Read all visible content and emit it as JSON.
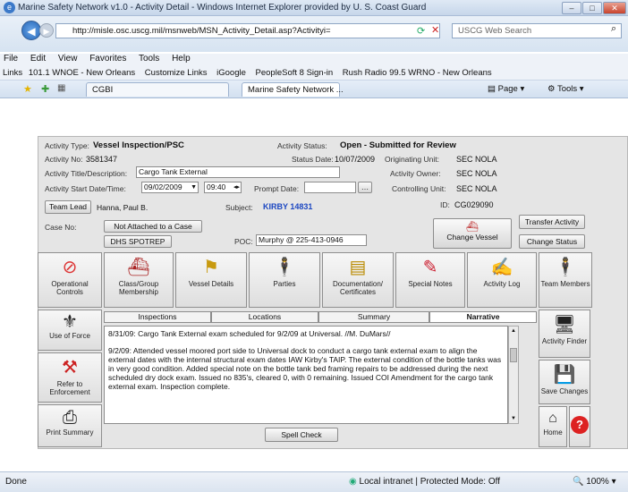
{
  "window": {
    "title": "Marine Safety Network v1.0 - Activity Detail - Windows Internet Explorer provided by U. S. Coast Guard"
  },
  "browser": {
    "address": "http://misle.osc.uscg.mil/msnweb/MSN_Activity_Detail.asp?Activityi=",
    "search_placeholder": "USCG Web Search",
    "menu": [
      "File",
      "Edit",
      "View",
      "Favorites",
      "Tools",
      "Help"
    ],
    "links": [
      "Links",
      "101.1 WNOE - New Orleans",
      "Customize Links",
      "iGoogle",
      "PeopleSoft 8 Sign-in",
      "Rush Radio 99.5 WRNO - New Orleans"
    ],
    "tabs": [
      "CGBI",
      "Marine Safety Network ..."
    ],
    "toolbar": {
      "page": "Page",
      "tools": "Tools"
    },
    "status": {
      "left": "Done",
      "zone": "Local intranet | Protected Mode: Off",
      "zoom": "100%"
    }
  },
  "activity": {
    "type_label": "Activity Type:",
    "type": "Vessel Inspection/PSC",
    "status_label": "Activity Status:",
    "status": "Open - Submitted for Review",
    "no_label": "Activity No:",
    "no": "3581347",
    "status_date_label": "Status Date:",
    "status_date": "10/07/2009",
    "orig_unit_label": "Originating Unit:",
    "orig_unit": "SEC NOLA",
    "title_label": "Activity Title/Description:",
    "title": "Cargo Tank External",
    "owner_label": "Activity Owner:",
    "owner": "SEC NOLA",
    "start_label": "Activity Start Date/Time:",
    "start_date": "09/02/2009",
    "start_time": "09:40",
    "prompt_label": "Prompt Date:",
    "ctrl_unit_label": "Controlling Unit:",
    "ctrl_unit": "SEC NOLA",
    "team_lead_btn": "Team Lead",
    "team_lead": "Hanna, Paul B.",
    "subject_label": "Subject:",
    "subject": "KIRBY 14831",
    "id_label": "ID:",
    "id": "CG029090",
    "case_label": "Case No:",
    "case_btn": "Not Attached to a Case",
    "spot_btn": "DHS SPOTREP",
    "poc_label": "POC:",
    "poc": "Murphy @ 225-413-0946",
    "change_vessel": "Change Vessel",
    "transfer": "Transfer Activity",
    "change_status": "Change Status"
  },
  "tiles": {
    "top": [
      {
        "label": "Operational Controls",
        "icon": "no-entry-icon"
      },
      {
        "label": "Class/Group Membership",
        "icon": "vessel-group-icon"
      },
      {
        "label": "Vessel Details",
        "icon": "flag-icon"
      },
      {
        "label": "Parties",
        "icon": "person-icon"
      },
      {
        "label": "Documentation/ Certificates",
        "icon": "document-stack-icon"
      },
      {
        "label": "Special Notes",
        "icon": "notes-icon"
      },
      {
        "label": "Activity Log",
        "icon": "handshake-icon"
      },
      {
        "label": "Team Members",
        "icon": "team-person-icon"
      }
    ],
    "left": [
      {
        "label": "Use of Force",
        "icon": "eagle-icon"
      },
      {
        "label": "Refer to Enforcement",
        "icon": "gavel-icon"
      },
      {
        "label": "Print Summary",
        "icon": "printer-icon"
      }
    ],
    "right": [
      {
        "label": "Activity Finder",
        "icon": "computer-icon"
      },
      {
        "label": "Save Changes",
        "icon": "floppy-icon"
      },
      {
        "label": "Home",
        "icon": "home-icon"
      },
      {
        "label": "?",
        "icon": "help-icon"
      }
    ]
  },
  "subtabs": [
    "Inspections",
    "Locations",
    "Summary",
    "Narrative"
  ],
  "narrative": [
    "8/31/09: Cargo Tank External exam scheduled for 9/2/09 at Universal. //M. DuMars//",
    "9/2/09: Attended vessel moored port side to Universal dock to conduct a cargo tank external exam to align the external dates with the internal structural exam dates IAW Kirby's TAIP. The external condition of the bottle tanks was in very good condition. Added special note on the bottle tank bed framing repairs to be addressed during the next scheduled dry dock exam. Issued no 835's, cleared 0, with 0 remaining. Issued COI Amendment for the cargo tank external exam. Inspection complete."
  ],
  "spell_check": "Spell Check"
}
